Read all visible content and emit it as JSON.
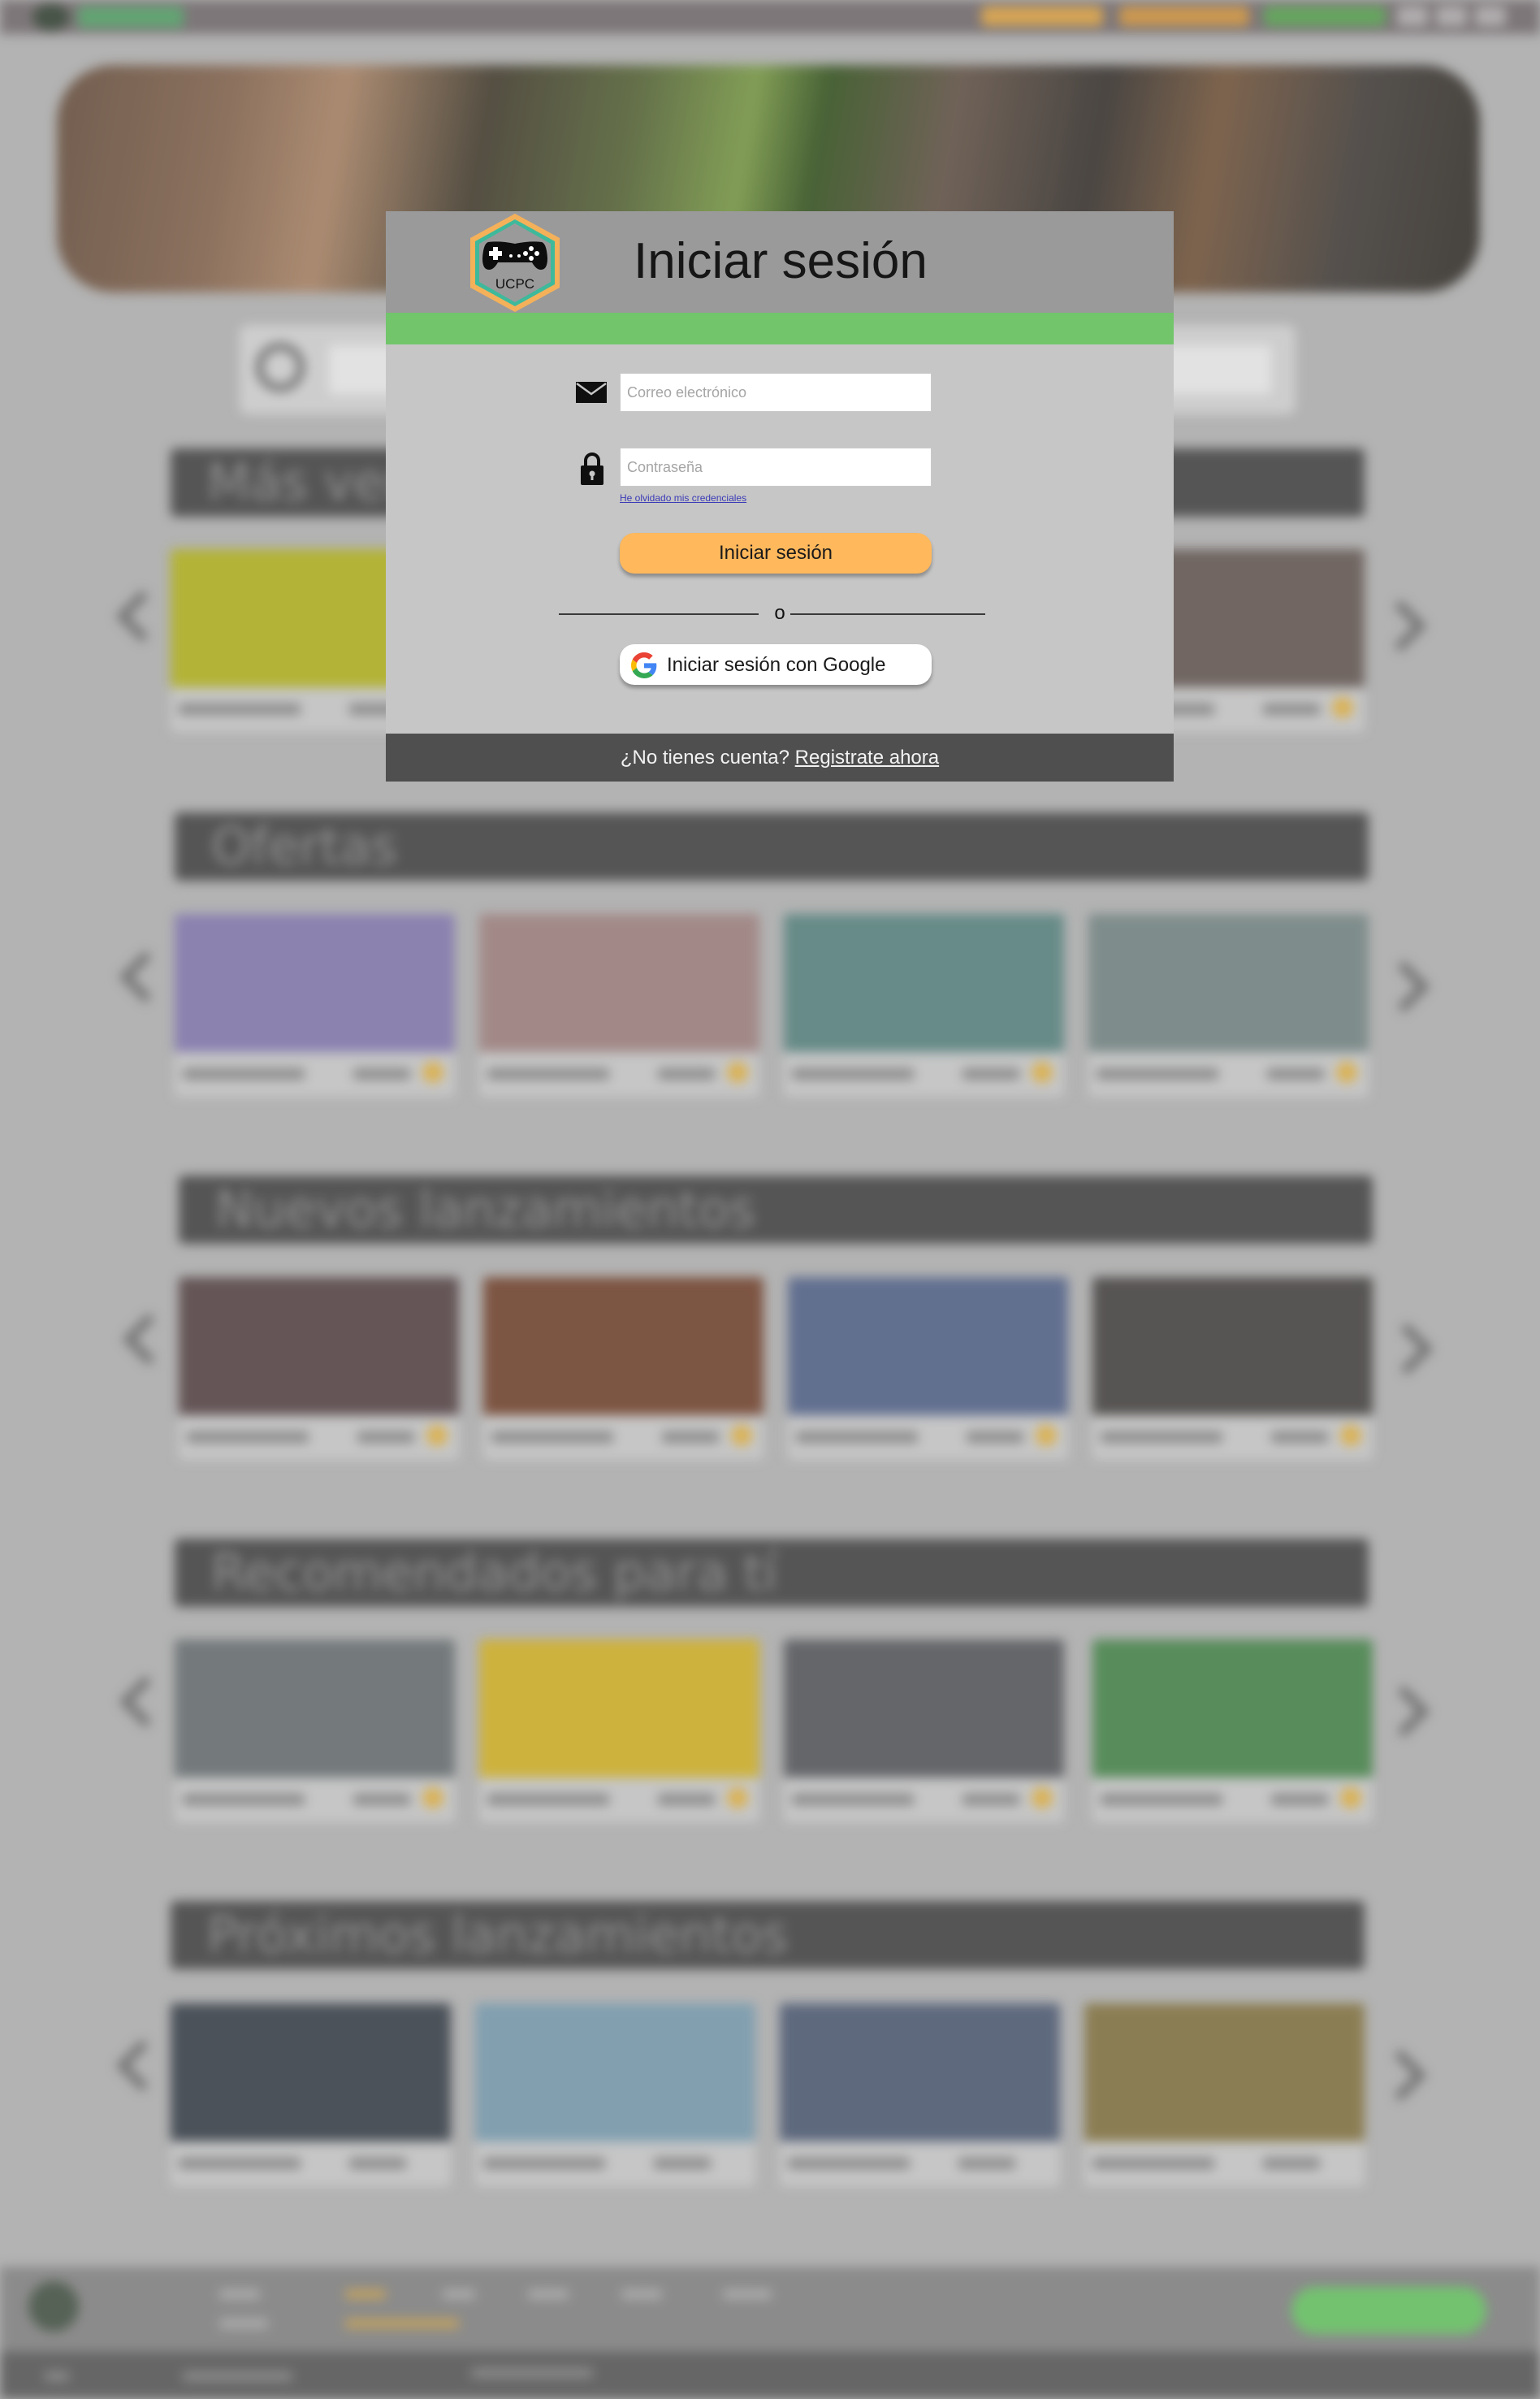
{
  "background": {
    "sections": [
      {
        "title": "Más vendidos"
      },
      {
        "title": "Ofertas"
      },
      {
        "title": "Nuevos lanzamientos"
      },
      {
        "title": "Recomendados para tí"
      },
      {
        "title": "Próximos lanzamientos"
      }
    ]
  },
  "modal": {
    "logo_text": "UCPC",
    "title": "Iniciar sesión",
    "email_placeholder": "Correo electrónico",
    "password_placeholder": "Contraseña",
    "forgot_link": "He olvidado mis credenciales",
    "login_button": "Iniciar sesión",
    "divider_text": "o",
    "google_button": "Iniciar sesión con Google",
    "no_account_text": "¿No tienes cuenta?",
    "register_link": "Registrate ahora"
  },
  "colors": {
    "header": "#9a9a9a",
    "stripe": "#72c56b",
    "login_button": "#ffb85c",
    "footer": "#4f4f4f",
    "logo_border_orange": "#f4b15a",
    "logo_border_teal": "#3fb99b"
  },
  "icons": {
    "email": "envelope-icon",
    "password": "lock-icon",
    "google": "google-logo-icon",
    "logo": "gamepad-icon"
  }
}
